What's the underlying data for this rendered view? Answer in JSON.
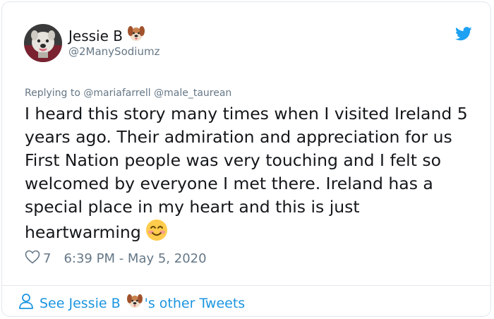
{
  "tweet": {
    "display_name": "Jessie B",
    "handle": "@2ManySodiumz",
    "replying_to": "Replying to @mariafarrell @male_taurean",
    "text": "I heard this story many times when I visited Ireland 5 years ago. Their admiration and appreciation for us First Nation people was very touching and I felt so welcomed by everyone I met there. Ireland has a special place in my heart and this is just heartwarming",
    "likes": "7",
    "timestamp": "6:39 PM - May 5, 2020"
  },
  "footer": {
    "link_prefix": "See Jessie B",
    "link_suffix": "'s other Tweets"
  },
  "icons": {
    "name_emoji": "dog-face-icon",
    "brand": "twitter-bird-icon",
    "like": "heart-outline-icon",
    "text_emoji": "smiling-face-icon",
    "footer_person": "person-icon"
  },
  "colors": {
    "twitter_blue": "#1da1f2",
    "link_blue": "#1b95e0",
    "muted": "#657786",
    "text": "#14171a",
    "border": "#e1e8ed"
  }
}
